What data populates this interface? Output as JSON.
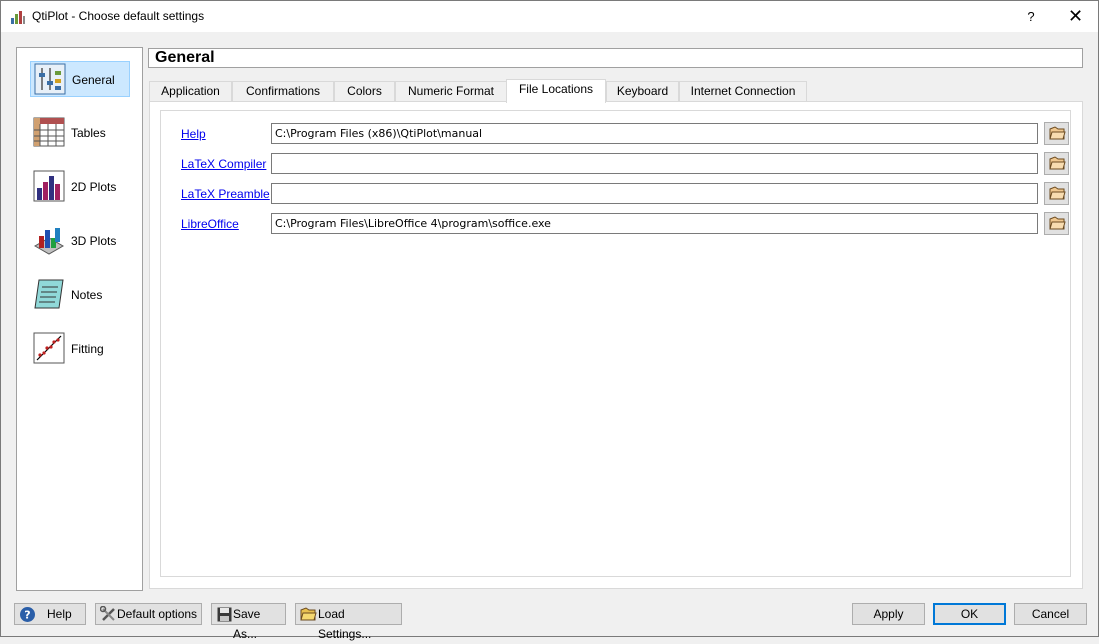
{
  "window": {
    "title": "QtiPlot - Choose default settings",
    "help_glyph": "?",
    "close_glyph": "✕"
  },
  "sidebar": {
    "items": [
      {
        "label": "General",
        "icon": "general-settings-icon",
        "selected": true
      },
      {
        "label": "Tables",
        "icon": "table-icon",
        "selected": false
      },
      {
        "label": "2D Plots",
        "icon": "bar-chart-icon",
        "selected": false
      },
      {
        "label": "3D Plots",
        "icon": "3d-bar-chart-icon",
        "selected": false
      },
      {
        "label": "Notes",
        "icon": "notes-icon",
        "selected": false
      },
      {
        "label": "Fitting",
        "icon": "fitting-curve-icon",
        "selected": false
      }
    ]
  },
  "section": {
    "title": "General"
  },
  "tabs": [
    {
      "label": "Application"
    },
    {
      "label": "Confirmations"
    },
    {
      "label": "Colors"
    },
    {
      "label": "Numeric Format"
    },
    {
      "label": "File Locations",
      "active": true
    },
    {
      "label": "Keyboard"
    },
    {
      "label": "Internet Connection"
    }
  ],
  "file_locations": {
    "rows": [
      {
        "label": "Help",
        "value": "C:\\Program Files (x86)\\QtiPlot\\manual"
      },
      {
        "label": "LaTeX Compiler",
        "value": ""
      },
      {
        "label": "LaTeX Preamble",
        "value": ""
      },
      {
        "label": "LibreOffice",
        "value": "C:\\Program Files\\LibreOffice 4\\program\\soffice.exe"
      }
    ]
  },
  "footer": {
    "help": "Help",
    "default_options": "Default options",
    "save_as": "Save As...",
    "load_settings": "Load Settings...",
    "apply": "Apply",
    "ok": "OK",
    "cancel": "Cancel"
  },
  "colors": {
    "selection_bg": "#cce8ff",
    "link": "#0000ee",
    "default_button_border": "#0078d7"
  }
}
